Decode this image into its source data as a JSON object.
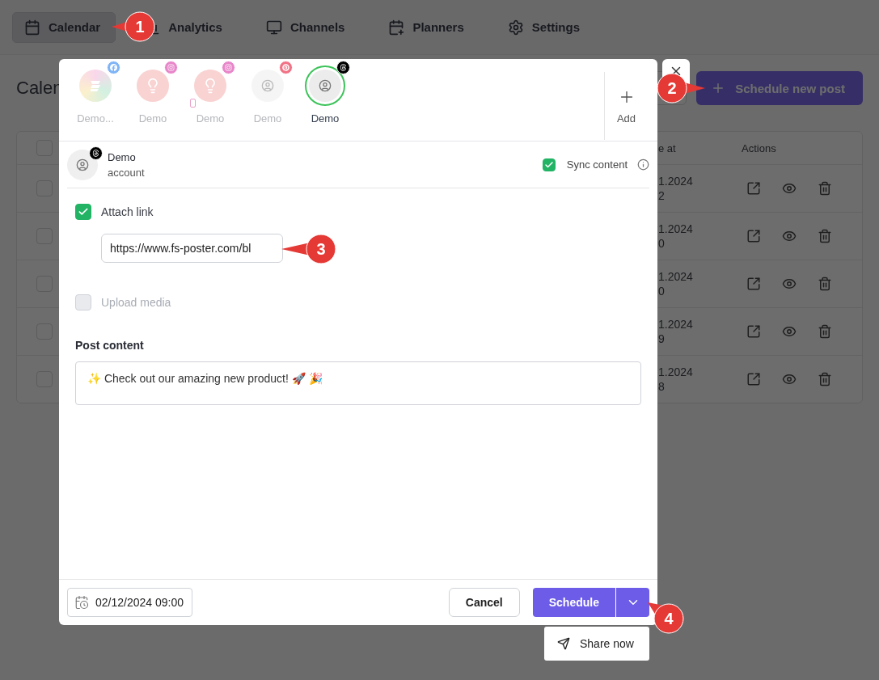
{
  "nav": {
    "tabs": [
      {
        "label": "Calendar",
        "selected": true
      },
      {
        "label": "Analytics",
        "selected": false
      },
      {
        "label": "Channels",
        "selected": false
      },
      {
        "label": "Planners",
        "selected": false
      },
      {
        "label": "Settings",
        "selected": false
      }
    ]
  },
  "page": {
    "title": "Calen",
    "primary_button": "Schedule new post",
    "table": {
      "columns": [
        "e at",
        "Actions"
      ],
      "header_checked": false,
      "rows": [
        {
          "checked": false,
          "date": "1.2024",
          "time": "2"
        },
        {
          "checked": false,
          "date": "1.2024",
          "time": "0"
        },
        {
          "checked": false,
          "date": "1.2024",
          "time": "0"
        },
        {
          "checked": false,
          "date": "1.2024",
          "time": "9"
        },
        {
          "checked": false,
          "date": "1.2024",
          "time": "8"
        }
      ]
    }
  },
  "modal": {
    "accounts": [
      {
        "label": "Demo...",
        "selected": false
      },
      {
        "label": "Demo",
        "selected": false
      },
      {
        "label": "Demo",
        "selected": false
      },
      {
        "label": "Demo",
        "selected": false
      },
      {
        "label": "Demo",
        "selected": true
      }
    ],
    "add_label": "Add",
    "account": {
      "name": "Demo",
      "subtitle": "account"
    },
    "sync": {
      "label": "Sync content",
      "checked": true
    },
    "attach_link": {
      "label": "Attach link",
      "checked": true
    },
    "link_value": "https://www.fs-poster.com/bl",
    "upload_media": {
      "label": "Upload media",
      "checked": false,
      "disabled": true
    },
    "content_label": "Post content",
    "content_value": "✨ Check out our amazing new product! 🚀 🎉",
    "date": "02/12/2024 09:00",
    "cancel": "Cancel",
    "schedule": "Schedule",
    "schedule_menu": {
      "expanded": true,
      "items": [
        {
          "label": "Share now"
        }
      ]
    }
  },
  "callouts": [
    {
      "label": "1"
    },
    {
      "label": "2"
    },
    {
      "label": "3"
    },
    {
      "label": "4"
    }
  ]
}
